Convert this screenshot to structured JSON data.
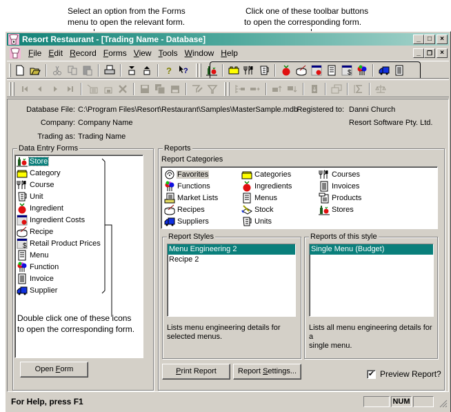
{
  "callouts": {
    "left": [
      "Select an option from the Forms",
      "menu to open the relevant form."
    ],
    "right": [
      "Click one of these toolbar buttons",
      "to open the corresponding form."
    ]
  },
  "window": {
    "title": "Resort Restaurant - [Trading Name - Database]",
    "controls": {
      "minimize": "_",
      "maximize": "□",
      "close": "×",
      "restore": "🗗"
    }
  },
  "menu": [
    {
      "label": "File",
      "accel": "F"
    },
    {
      "label": "Edit",
      "accel": "E"
    },
    {
      "label": "Record",
      "accel": "R"
    },
    {
      "label": "Forms",
      "accel": "F"
    },
    {
      "label": "View",
      "accel": "V"
    },
    {
      "label": "Tools",
      "accel": "T"
    },
    {
      "label": "Window",
      "accel": "W"
    },
    {
      "label": "Help",
      "accel": "H"
    }
  ],
  "toolbar1": {
    "standard": [
      "new-icon",
      "open-icon",
      "cut-icon",
      "copy-icon",
      "paste-icon",
      "print-icon",
      "move-down-icon",
      "move-up-icon",
      "help-icon",
      "context-help-icon"
    ],
    "forms": [
      "store-icon",
      "category-icon",
      "course-icon",
      "unit-icon",
      "ingredient-icon",
      "recipe-icon",
      "ingredient-costs-icon",
      "menu-icon",
      "retail-prices-icon",
      "function-icon",
      "supplier-icon",
      "invoice-icon"
    ]
  },
  "toolbar2": {
    "navigation": [
      "first-record-icon",
      "previous-record-icon",
      "next-record-icon",
      "last-record-icon",
      "new-record-icon",
      "copy-record-icon",
      "delete-record-icon",
      "save-icon",
      "save-all-icon",
      "save-close-icon",
      "filter-apply-icon",
      "filter-icon"
    ],
    "other": [
      "remove-item-icon",
      "add-item-icon",
      "move-item-up-icon",
      "move-item-down-icon",
      "import-icon",
      "windows-icon",
      "sum-icon",
      "balance-icon"
    ]
  },
  "info": {
    "database_file_label": "Database File:",
    "database_file": "C:\\Program Files\\Resort\\Restaurant\\Samples\\MasterSample.mdb",
    "registered_to_label": "Registered to:",
    "registered_to": "Danni Church",
    "registered_company": "Resort Software Pty. Ltd.",
    "company_label": "Company:",
    "company": "Company Name",
    "trading_as_label": "Trading as:",
    "trading_as": "Trading Name"
  },
  "data_entry": {
    "title": "Data Entry Forms",
    "items": [
      {
        "label": "Store",
        "icon": "store-icon",
        "selected": true
      },
      {
        "label": "Category",
        "icon": "category-icon"
      },
      {
        "label": "Course",
        "icon": "course-icon"
      },
      {
        "label": "Unit",
        "icon": "unit-icon"
      },
      {
        "label": "Ingredient",
        "icon": "ingredient-icon"
      },
      {
        "label": "Ingredient Costs",
        "icon": "ingredient-costs-icon"
      },
      {
        "label": "Recipe",
        "icon": "recipe-icon"
      },
      {
        "label": "Retail Product Prices",
        "icon": "retail-prices-icon"
      },
      {
        "label": "Menu",
        "icon": "menu-icon"
      },
      {
        "label": "Function",
        "icon": "function-icon"
      },
      {
        "label": "Invoice",
        "icon": "invoice-icon"
      },
      {
        "label": "Supplier",
        "icon": "supplier-icon"
      }
    ],
    "hint": [
      "Double click one of these icons",
      "to open the corresponding form."
    ],
    "open_button": "Open Form"
  },
  "reports": {
    "title": "Reports",
    "categories_label": "Report Categories",
    "categories": [
      {
        "label": "Favorites",
        "icon": "favorites-icon",
        "highlighted": true
      },
      {
        "label": "Functions",
        "icon": "function-icon"
      },
      {
        "label": "Market Lists",
        "icon": "market-list-icon"
      },
      {
        "label": "Recipes",
        "icon": "recipe-icon"
      },
      {
        "label": "Suppliers",
        "icon": "supplier-icon"
      },
      {
        "label": "Categories",
        "icon": "category-icon"
      },
      {
        "label": "Ingredients",
        "icon": "ingredient-icon"
      },
      {
        "label": "Menus",
        "icon": "menu-icon"
      },
      {
        "label": "Stock",
        "icon": "stock-icon"
      },
      {
        "label": "Units",
        "icon": "unit-icon"
      },
      {
        "label": "Courses",
        "icon": "course-icon"
      },
      {
        "label": "Invoices",
        "icon": "invoice-icon"
      },
      {
        "label": "Products",
        "icon": "products-icon"
      },
      {
        "label": "Stores",
        "icon": "store-icon"
      }
    ],
    "styles_title": "Report Styles",
    "styles": [
      {
        "label": "Menu Engineering 2",
        "selected": true
      },
      {
        "label": "Recipe 2"
      }
    ],
    "styles_desc": [
      "Lists menu engineering details for",
      "selected menus."
    ],
    "reports_title": "Reports of this style",
    "reports_list": [
      {
        "label": "Single Menu (Budget)",
        "selected": true
      }
    ],
    "reports_desc": [
      "Lists all menu engineering details for a",
      "single menu."
    ],
    "print_button": "Print Report",
    "settings_button": "Report Settings...",
    "preview_label": "Preview Report?",
    "preview_checked": true
  },
  "status": {
    "text": "For Help, press F1",
    "num": "NUM"
  },
  "colors": {
    "selection": "#0a7f7b",
    "face": "#d4d0c8",
    "title_start": "#138277"
  }
}
